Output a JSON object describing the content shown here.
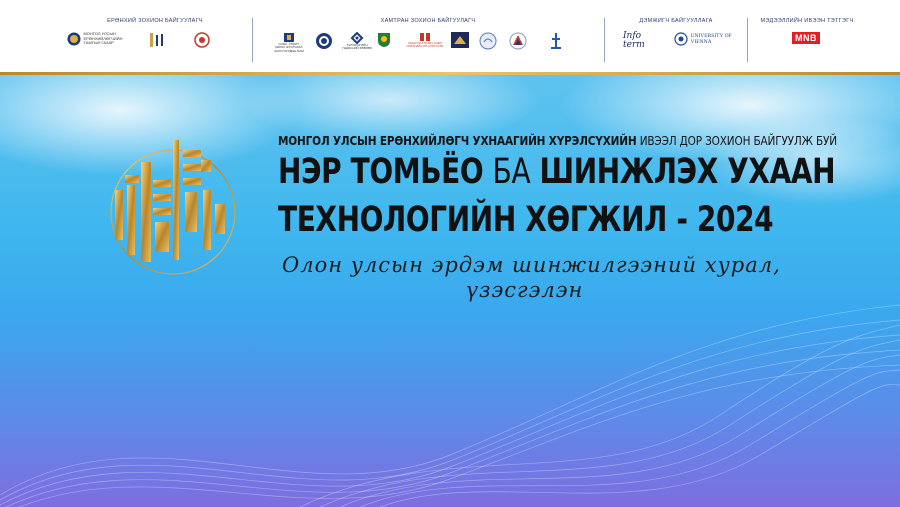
{
  "header": {
    "groups": [
      {
        "label": "ЕРӨНХИЙ ЗОХИОН БАЙГУУЛАГЧ",
        "logos": [
          {
            "name": "government-seal-logo",
            "text": "МОНГОЛ УЛСЫН ЕРӨНХИЙЛӨГЧИЙН ТАМГЫН ГАЗАР"
          },
          {
            "name": "mongolian-script-logo",
            "text": ""
          },
          {
            "name": "red-emblem-logo",
            "text": ""
          }
        ]
      },
      {
        "label": "ХАМТРАН ЗОХИОН БАЙГУУЛАГЧ",
        "logos": [
          {
            "name": "ministry-logo",
            "text": "СОЁЛ, СПОРТ, АЯЛАЛ ЖУУЛЧЛАЛ, ЗАЛУУЧУУДЫН ЯАМ"
          },
          {
            "name": "circle-seal-logo",
            "text": ""
          },
          {
            "name": "knot-logo",
            "text": "ХЭЛ БИЧГИЙН ҮНДЭСНИЙ ЗӨВЛӨЛ"
          },
          {
            "name": "university-shield-logo",
            "text": ""
          },
          {
            "name": "red-book-logo",
            "text": "МОНГОЛ УЛСЫН СОЁЛ УРЛАГИЙН ИХ СУРГУУЛЬ"
          },
          {
            "name": "academy-logo",
            "text": ""
          },
          {
            "name": "blue-circle-logo",
            "text": ""
          },
          {
            "name": "triangle-logo",
            "text": ""
          },
          {
            "name": "tower-logo",
            "text": ""
          }
        ]
      },
      {
        "label": "ДЭМЖИГЧ БАЙГУУЛЛАГА",
        "logos": [
          {
            "name": "infoterm-logo",
            "text": "Info term"
          },
          {
            "name": "university-of-vienna-logo",
            "text": "UNIVERSITY OF VIENNA"
          }
        ]
      },
      {
        "label": "МЭДЭЭЛЛИЙН ИВЭЭН ТЭТГЭГЧ",
        "logos": [
          {
            "name": "mnb-logo",
            "text": "MNB"
          }
        ]
      }
    ]
  },
  "hero": {
    "subtitle_bold": "МОНГОЛ УЛСЫН ЕРӨНХИЙЛӨГЧ УХНААГИЙН ХҮРЭЛСҮХИЙН",
    "subtitle_light": " ИВЭЭЛ ДОР ЗОХИОН БАЙГУУЛЖ БУЙ",
    "title_line1_a": "НЭР ТОМЬЁО ",
    "title_line1_b": "БА",
    "title_line1_c": " ШИНЖЛЭХ УХААН",
    "title_line2": "ТЕХНОЛОГИЙН ХӨГЖИЛ - 2024",
    "script_line1": "Олон улсын эрдэм шинжилгээний хурал,",
    "script_line2": "үзэсгэлэн"
  },
  "colors": {
    "gold": "#c9a24a",
    "sky": "#3fb7ee",
    "violet": "#7e6ee0"
  }
}
